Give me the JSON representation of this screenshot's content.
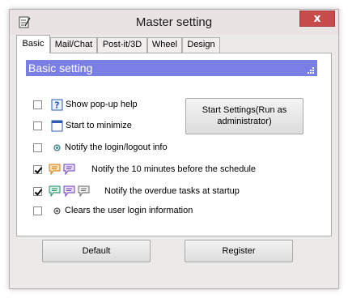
{
  "window": {
    "title": "Master setting",
    "close_glyph": "x",
    "title_icon": "notepad-icon"
  },
  "tabs": [
    {
      "label": "Basic",
      "active": true
    },
    {
      "label": "Mail/Chat",
      "active": false
    },
    {
      "label": "Post-it/3D",
      "active": false
    },
    {
      "label": "Wheel",
      "active": false
    },
    {
      "label": "Design",
      "active": false
    }
  ],
  "section": {
    "title": "Basic setting",
    "color": "#7a7fe6"
  },
  "options": [
    {
      "label": "Show pop-up help",
      "checked": false,
      "icons": [
        "help-icon"
      ]
    },
    {
      "label": "Start to minimize",
      "checked": false,
      "icons": [
        "window-icon"
      ]
    },
    {
      "label": "Notify the login/logout info",
      "checked": false,
      "icons": [
        "small-circle-icon"
      ]
    },
    {
      "label": "Notify the 10 minutes before the schedule",
      "checked": true,
      "icons": [
        "orange-memo-icon",
        "purple-memo-icon"
      ]
    },
    {
      "label": "Notify the overdue tasks at startup",
      "checked": true,
      "icons": [
        "green-memo-icon",
        "purple-memo-icon",
        "gray-memo-icon"
      ]
    },
    {
      "label": "Clears the user login information",
      "checked": false,
      "icons": [
        "small-circle-icon"
      ]
    }
  ],
  "buttons": {
    "start_settings": "Start Settings(Run as administrator)",
    "default": "Default",
    "register": "Register"
  }
}
